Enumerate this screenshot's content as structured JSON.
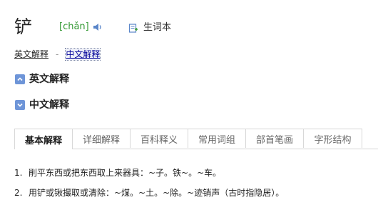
{
  "entry": {
    "headword": "铲",
    "pinyin": "[chǎn]",
    "vocab_label": "生词本"
  },
  "quicklinks": {
    "english": "英文解释",
    "separator": "-",
    "chinese": "中文解释"
  },
  "sections": {
    "english_title": "英文解释",
    "chinese_title": "中文解释"
  },
  "tabs": [
    {
      "label": "基本解释",
      "active": true
    },
    {
      "label": "详细解释",
      "active": false
    },
    {
      "label": "百科释义",
      "active": false
    },
    {
      "label": "常用词组",
      "active": false
    },
    {
      "label": "部首笔画",
      "active": false
    },
    {
      "label": "字形结构",
      "active": false
    }
  ],
  "definitions": [
    {
      "num": "1.",
      "text": "削平东西或把东西取上来器具：~子。铁~。~车。"
    },
    {
      "num": "2.",
      "text": "用铲或锹撮取或清除：~煤。~土。~除。~迹销声（古时指隐居）。"
    }
  ],
  "colors": {
    "pinyin": "#339933",
    "section_box": "#6e95d8",
    "speaker": "#5a86c9"
  }
}
